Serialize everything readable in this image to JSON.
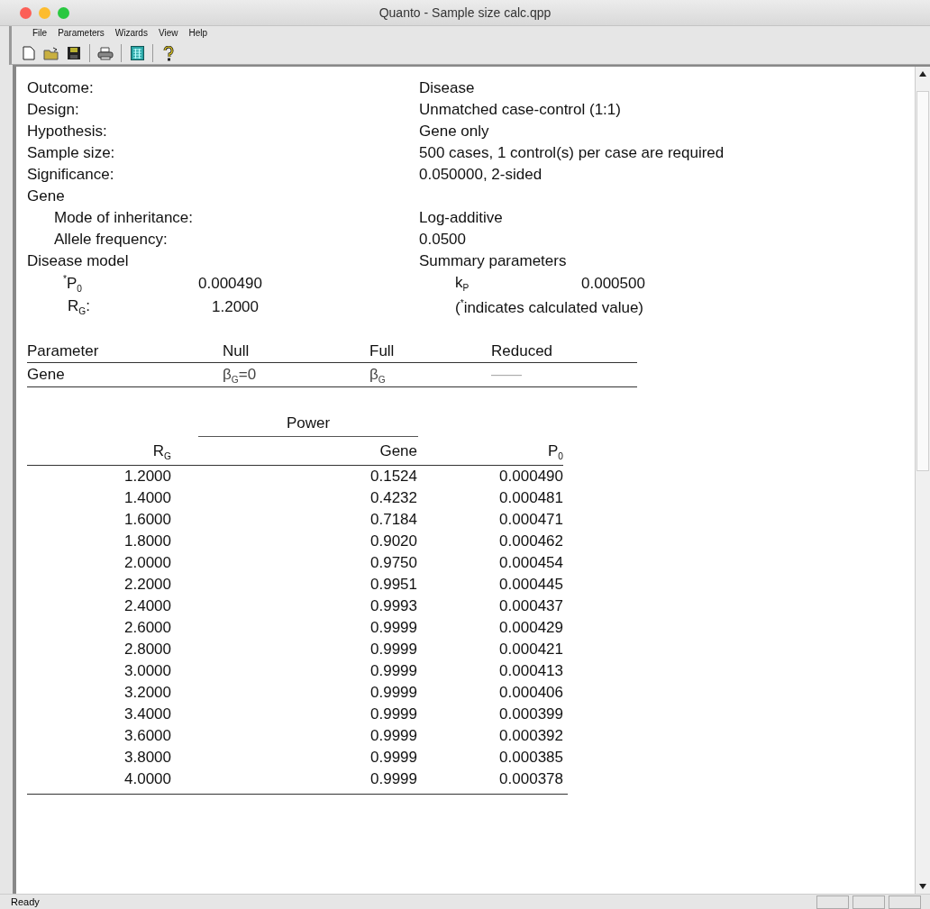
{
  "window": {
    "title": "Quanto - Sample size calc.qpp"
  },
  "menu": [
    "File",
    "Parameters",
    "Wizards",
    "View",
    "Help"
  ],
  "toolbar": [
    {
      "kind": "new"
    },
    {
      "kind": "open"
    },
    {
      "kind": "save"
    },
    {
      "kind": "separator"
    },
    {
      "kind": "print"
    },
    {
      "kind": "separator"
    },
    {
      "kind": "calculator"
    },
    {
      "kind": "separator"
    },
    {
      "kind": "help"
    }
  ],
  "summary": [
    {
      "label": "Outcome:",
      "value": "Disease"
    },
    {
      "label": "Design:",
      "value": "Unmatched case-control (1:1)"
    },
    {
      "label": "Hypothesis:",
      "value": "Gene only"
    },
    {
      "label": "Sample size:",
      "value": "500 cases, 1 control(s) per case are required"
    },
    {
      "label": "Significance:",
      "value": "0.050000, 2-sided"
    },
    {
      "label": "Gene",
      "children": [
        {
          "label": "Mode of inheritance:",
          "value": "Log-additive"
        },
        {
          "label": "Allele frequency:",
          "value": "0.0500"
        }
      ]
    }
  ],
  "disease_model": {
    "label": "Disease model",
    "summary_label": "Summary parameters",
    "params": [
      {
        "name": "$^{*}$P$_{0}$",
        "value": "0.000490"
      },
      {
        "name": "R$_{G}$:",
        "value": "1.2000"
      }
    ],
    "summary_params": [
      {
        "name": "k$_{P}$",
        "value": "0.000500"
      }
    ],
    "note": "($^{*}$indicates calculated value)"
  },
  "parameter_table": {
    "columns": [
      "Parameter",
      "Null",
      "Full",
      "Reduced"
    ],
    "rows": [
      [
        "Gene",
        "β$_{G}$=0",
        "β$_{G}$",
        "——"
      ]
    ]
  },
  "power_table": {
    "group_header": "Power",
    "columns": [
      "R$_{G}$",
      "Gene",
      "P$_{0}$"
    ],
    "rows": [
      [
        "1.2000",
        "0.1524",
        "0.000490"
      ],
      [
        "1.4000",
        "0.4232",
        "0.000481"
      ],
      [
        "1.6000",
        "0.7184",
        "0.000471"
      ],
      [
        "1.8000",
        "0.9020",
        "0.000462"
      ],
      [
        "2.0000",
        "0.9750",
        "0.000454"
      ],
      [
        "2.2000",
        "0.9951",
        "0.000445"
      ],
      [
        "2.4000",
        "0.9993",
        "0.000437"
      ],
      [
        "2.6000",
        "0.9999",
        "0.000429"
      ],
      [
        "2.8000",
        "0.9999",
        "0.000421"
      ],
      [
        "3.0000",
        "0.9999",
        "0.000413"
      ],
      [
        "3.2000",
        "0.9999",
        "0.000406"
      ],
      [
        "3.4000",
        "0.9999",
        "0.000399"
      ],
      [
        "3.6000",
        "0.9999",
        "0.000392"
      ],
      [
        "3.8000",
        "0.9999",
        "0.000385"
      ],
      [
        "4.0000",
        "0.9999",
        "0.000378"
      ]
    ]
  },
  "status_bar": {
    "text": "Ready"
  }
}
